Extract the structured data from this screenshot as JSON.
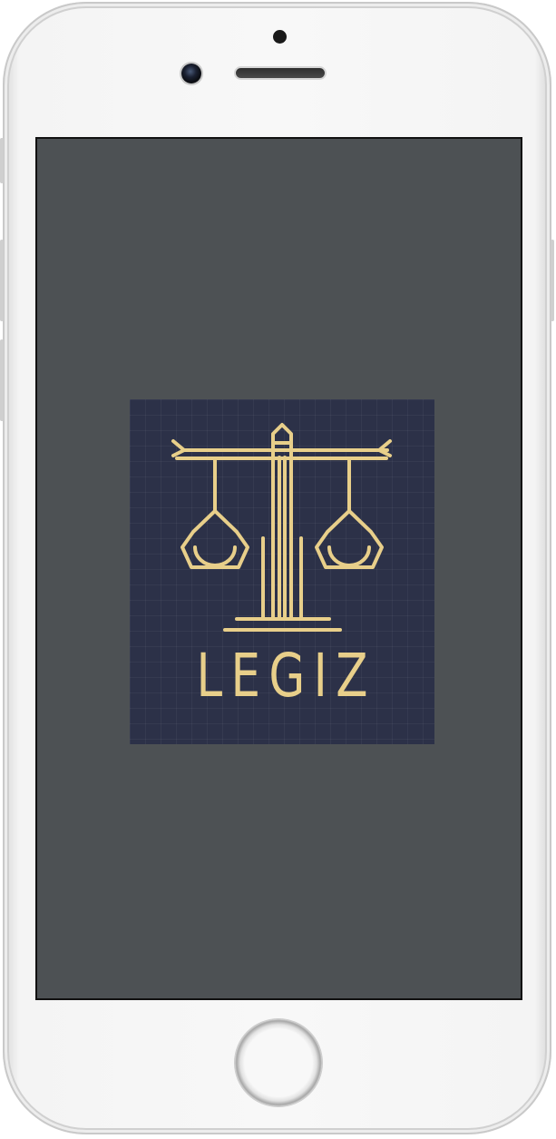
{
  "device": {
    "frame_color": "#f6f6f6",
    "screen_color": "#4d5154"
  },
  "splash": {
    "brand_name": "LEGIZ",
    "logo_background": "#2c3148",
    "logo_accent": "#e8cf8a",
    "logo_icon": "scales-of-justice-icon"
  }
}
